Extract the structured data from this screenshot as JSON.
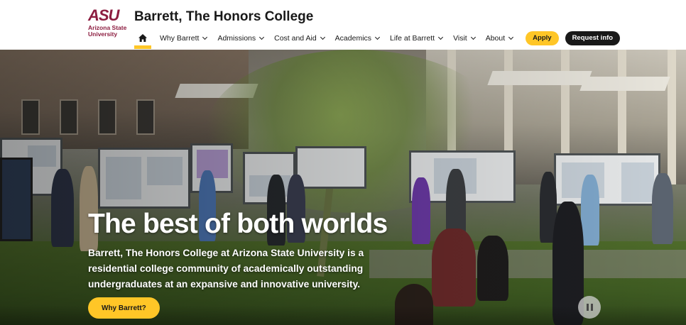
{
  "brand": {
    "logo_mark": "ASU",
    "logo_sub": "Arizona State University",
    "site_title": "Barrett, The Honors College"
  },
  "nav": {
    "home_icon": "home-icon",
    "items": [
      {
        "label": "Why Barrett"
      },
      {
        "label": "Admissions"
      },
      {
        "label": "Cost and Aid"
      },
      {
        "label": "Academics"
      },
      {
        "label": "Life at Barrett"
      },
      {
        "label": "Visit"
      },
      {
        "label": "About"
      }
    ],
    "apply_label": "Apply",
    "request_label": "Request info"
  },
  "hero": {
    "headline": "The best of both worlds",
    "intro": "Barrett, The Honors College at Arizona State University is a residential college community of academically outstanding undergraduates at an expansive and innovative university.",
    "cta_label": "Why Barrett?",
    "pause_icon": "pause-icon"
  },
  "colors": {
    "asu_maroon": "#8c1d40",
    "asu_gold": "#ffc627",
    "dark": "#191919"
  }
}
